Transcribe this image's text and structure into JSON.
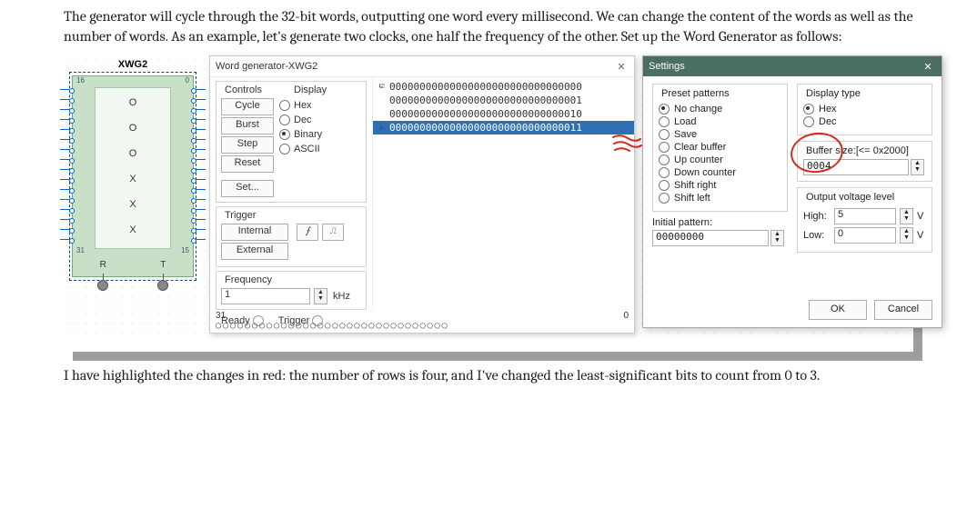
{
  "intro_text": "The generator will cycle through the 32-bit words, outputting one word every millisecond. We can change the content of the words as well as the number of words. As an example, let's generate two clocks, one half the frequency of the other. Set up the Word Generator as follows:",
  "outro_text": "I have highlighted the changes in red: the number of rows is four, and I've changed the least-significant bits to count from 0 to 3.",
  "xwg2": {
    "title": "XWG2",
    "top_left": "16",
    "top_right": "0",
    "bot_left": "31",
    "bot_right": "15",
    "inner_rows": [
      "O",
      "",
      "O",
      "",
      "O",
      "",
      "X",
      "",
      "X",
      "",
      "X"
    ],
    "foot_l": "R",
    "foot_r": "T"
  },
  "wg": {
    "title": "Word generator-XWG2",
    "controls_label": "Controls",
    "display_label": "Display",
    "buttons": {
      "cycle": "Cycle",
      "burst": "Burst",
      "step": "Step",
      "reset": "Reset",
      "set": "Set..."
    },
    "display_opts": {
      "hex": "Hex",
      "dec": "Dec",
      "binary": "Binary",
      "ascii": "ASCII"
    },
    "display_selected": 2,
    "trigger_label": "Trigger",
    "trigger_internal": "Internal",
    "trigger_external": "External",
    "edge_rise": "⨍",
    "edge_fall": "⎍",
    "frequency_label": "Frequency",
    "frequency_value": "1",
    "frequency_unit": "kHz",
    "ready_label": "Ready",
    "trigger_ind_label": "Trigger",
    "words": [
      "00000000000000000000000000000000",
      "00000000000000000000000000000001",
      "00000000000000000000000000000010",
      "00000000000000000000000000000011"
    ],
    "selected_word_index": 3,
    "ruler_left": "31",
    "ruler_right": "0",
    "ruler_dots": "◯◯◯◯◯◯◯◯◯◯◯◯◯◯◯◯◯◯◯◯◯◯◯◯◯◯◯◯◯◯◯◯"
  },
  "settings": {
    "title": "Settings",
    "preset_label": "Preset patterns",
    "presets": {
      "nochange": "No change",
      "load": "Load",
      "save": "Save",
      "clear": "Clear buffer",
      "up": "Up counter",
      "down": "Down counter",
      "sright": "Shift right",
      "sleft": "Shift left"
    },
    "preset_selected": 0,
    "initial_label": "Initial pattern:",
    "initial_value": "00000000",
    "display_type_label": "Display type",
    "disp_opts": {
      "hex": "Hex",
      "dec": "Dec"
    },
    "disp_selected": 0,
    "buffer_label": "Buffer size:[<= 0x2000]",
    "buffer_value": "0004",
    "voltage_label": "Output voltage level",
    "high_label": "High:",
    "high_value": "5",
    "low_label": "Low:",
    "low_value": "0",
    "volt_unit": "V",
    "ok": "OK",
    "cancel": "Cancel"
  }
}
